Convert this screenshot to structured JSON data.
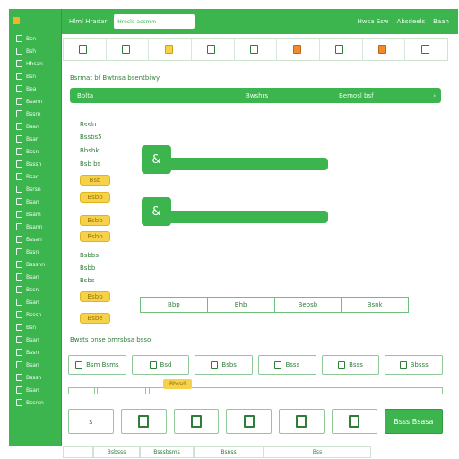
{
  "app": {
    "title": "Hlml Hradar",
    "search_placeholder": "Hrecle acsmm"
  },
  "topbar": {
    "links": [
      "Hwsa Ssw",
      "Absdeels",
      "Baah"
    ]
  },
  "sidebar": {
    "items": [
      {
        "label": "Bsn",
        "icon": "doc-icon"
      },
      {
        "label": "Bsh",
        "icon": "doc-icon"
      },
      {
        "label": "Hbsan",
        "icon": "list-icon"
      },
      {
        "label": "Bsn",
        "icon": "doc-icon"
      },
      {
        "label": "Bea",
        "icon": "doc-icon"
      },
      {
        "label": "Bsann",
        "icon": "doc-icon"
      },
      {
        "label": "Bssrn",
        "icon": "doc-icon"
      },
      {
        "label": "Bsan",
        "icon": "doc-icon"
      },
      {
        "label": "Bsar",
        "icon": "doc-icon"
      },
      {
        "label": "Bssn",
        "icon": "doc-icon"
      },
      {
        "label": "Bsssn",
        "icon": "doc-icon"
      },
      {
        "label": "Bsar",
        "icon": "doc-icon"
      },
      {
        "label": "Bsrsn",
        "icon": "doc-icon"
      },
      {
        "label": "Bsan",
        "icon": "doc-icon"
      },
      {
        "label": "Bsam",
        "icon": "doc-icon"
      },
      {
        "label": "Bsann",
        "icon": "doc-icon"
      },
      {
        "label": "Bssan",
        "icon": "doc-icon"
      },
      {
        "label": "Bssn",
        "icon": "doc-icon"
      },
      {
        "label": "Bsssnn",
        "icon": "doc-icon"
      },
      {
        "label": "Bsan",
        "icon": "doc-icon"
      },
      {
        "label": "Bssn",
        "icon": "doc-icon"
      },
      {
        "label": "Bsan",
        "icon": "doc-icon"
      },
      {
        "label": "Bsssn",
        "icon": "doc-icon"
      },
      {
        "label": "Bsn",
        "icon": "doc-icon"
      },
      {
        "label": "Bsan",
        "icon": "doc-icon"
      },
      {
        "label": "Bssn",
        "icon": "doc-icon"
      },
      {
        "label": "Bsan",
        "icon": "doc-icon"
      },
      {
        "label": "Bsssn",
        "icon": "doc-icon"
      },
      {
        "label": "Bsan",
        "icon": "doc-icon"
      },
      {
        "label": "Bssrsn",
        "icon": "doc-icon"
      }
    ]
  },
  "toolbar": {
    "tools": [
      {
        "label": "",
        "icon": "edit-icon"
      },
      {
        "label": "",
        "icon": "chart-icon"
      },
      {
        "label": "",
        "icon": "folder-icon",
        "tone": "y"
      },
      {
        "label": "",
        "icon": "image-icon"
      },
      {
        "label": "",
        "icon": "grid-icon"
      },
      {
        "label": "",
        "icon": "warning-icon",
        "tone": "o"
      },
      {
        "label": "",
        "icon": "box-icon"
      },
      {
        "label": "",
        "icon": "user-icon",
        "tone": "o"
      },
      {
        "label": "",
        "icon": "pie-icon"
      }
    ]
  },
  "section": {
    "title": "Bsrmat bf Bwtnsa bsentbiwy",
    "bar_labels": [
      "Bblta",
      "Bwshrs",
      "Bemosl bsf"
    ]
  },
  "fields": [
    {
      "label": "Bsslu",
      "tone": "plain"
    },
    {
      "label": "Bssbs5",
      "tone": "plain"
    },
    {
      "label": "Bbsbk",
      "tone": "plain"
    },
    {
      "label": "Bsb bs",
      "tone": "plain"
    },
    {
      "label": "Bsb",
      "tone": "y"
    },
    {
      "label": "Bsbb",
      "tone": "y"
    },
    {
      "label": "Bsbb",
      "tone": "y"
    },
    {
      "label": "Bsbb",
      "tone": "y"
    },
    {
      "label": "Bsbbs",
      "tone": "plain"
    },
    {
      "label": "Bsbb",
      "tone": "plain"
    },
    {
      "label": "Bsbs",
      "tone": "plain"
    },
    {
      "label": "Bsbb",
      "tone": "y"
    },
    {
      "label": "Bsbe",
      "tone": "y"
    }
  ],
  "progress": [
    {
      "icon": "user-icon",
      "glyph": "&"
    },
    {
      "icon": "check-user-icon",
      "glyph": "&"
    }
  ],
  "segtable": [
    "Bbp",
    "Bhb",
    "Bebsb",
    "Bsnk"
  ],
  "section2": {
    "title": "Bwsts bnse bmrsbsa bsso"
  },
  "row1": [
    {
      "label": "Bsm Bsms",
      "icon": "doc-icon"
    },
    {
      "label": "Bsd",
      "icon": "doc-icon"
    },
    {
      "label": "Bsbs",
      "icon": "chart-icon"
    },
    {
      "label": "Bsss",
      "icon": "doc-icon"
    },
    {
      "label": "Bsss",
      "icon": "doc-icon"
    },
    {
      "label": "Bbsss",
      "icon": "doc-icon"
    }
  ],
  "row2": {
    "tag": "Bbssd"
  },
  "row3": [
    {
      "label": "s",
      "icon": ""
    },
    {
      "label": "",
      "icon": "chart-icon"
    },
    {
      "label": "",
      "icon": "doc-icon"
    },
    {
      "label": "",
      "icon": "image-icon"
    },
    {
      "label": "",
      "icon": "chart-icon"
    },
    {
      "label": "",
      "icon": "doc-icon"
    }
  ],
  "cta": {
    "label": "Bsss Bsasa"
  },
  "bottom": [
    "",
    "Bsbsss",
    "Bsssbsms",
    "Bsnss",
    "Bss"
  ],
  "colors": {
    "accent": "#3cb54e",
    "yellow": "#f6d24a",
    "orange": "#f08a2c"
  }
}
